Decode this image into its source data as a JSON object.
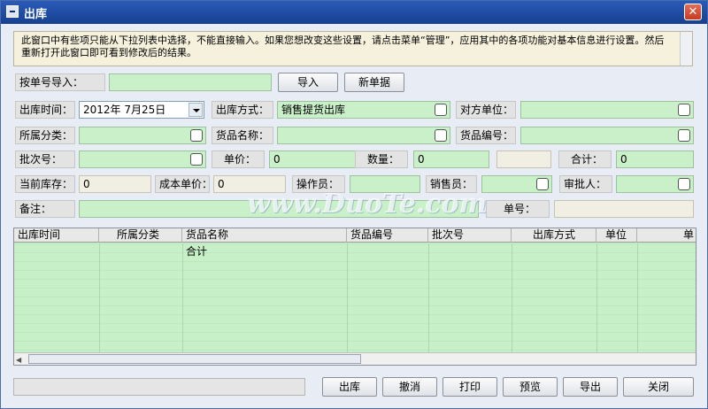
{
  "window": {
    "title": "出库"
  },
  "info_text": "此窗口中有些项只能从下拉列表中选择，不能直接输入。如果您想改变这些设置，请点击菜单“管理”，应用其中的各项功能对基本信息进行设置。然后重新打开此窗口即可看到修改后的结果。",
  "import": {
    "label": "按单号导入：",
    "value": "",
    "import_btn": "导入",
    "new_btn": "新单据"
  },
  "form": {
    "date_label": "出库时间：",
    "date_value": "2012年 7月25日",
    "method_label": "出库方式：",
    "method_value": "销售提货出库",
    "partner_label": "对方单位：",
    "partner_value": "",
    "category_label": "所属分类：",
    "category_value": "",
    "goods_name_label": "货品名称：",
    "goods_name_value": "",
    "goods_no_label": "货品编号：",
    "goods_no_value": "",
    "batch_label": "批次号：",
    "batch_value": "",
    "price_label": "单价：",
    "price_value": "0",
    "qty_label": "数量：",
    "qty_value": "0",
    "total_label": "合计：",
    "total_value": "0",
    "stock_label": "当前库存：",
    "stock_value": "0",
    "cost_label": "成本单价：",
    "cost_value": "0",
    "operator_label": "操作员：",
    "operator_value": "",
    "seller_label": "销售员：",
    "seller_value": "",
    "approver_label": "审批人：",
    "approver_value": "",
    "note_label": "备注：",
    "note_value": "",
    "doc_no_label": "单号：",
    "doc_no_value": ""
  },
  "table": {
    "columns": [
      "出库时间",
      "所属分类",
      "货品名称",
      "货品编号",
      "批次号",
      "出库方式",
      "单位",
      "单"
    ],
    "total_row_label": "合计"
  },
  "buttons": {
    "out": "出库",
    "cancel": "撤消",
    "print": "打印",
    "preview": "预览",
    "export": "导出",
    "close": "关闭"
  },
  "watermark": "www.DuoTe.com"
}
